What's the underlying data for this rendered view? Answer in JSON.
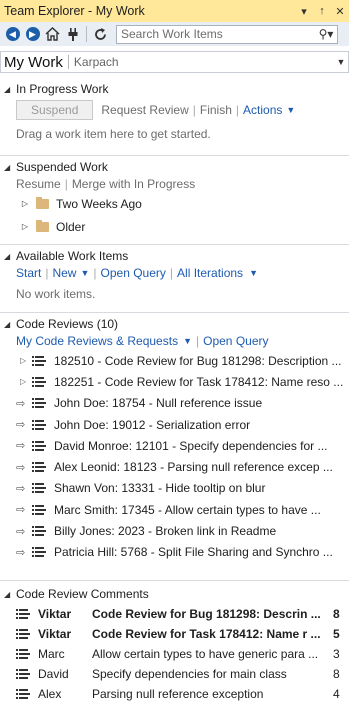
{
  "window": {
    "title": "Team Explorer - My Work",
    "pin": "↑",
    "dropdown": "▾",
    "close": "✕"
  },
  "toolbar": {
    "search_placeholder": "Search Work Items"
  },
  "nav": {
    "title": "My Work",
    "context": "Karpach"
  },
  "in_progress": {
    "header": "In Progress Work",
    "suspend": "Suspend",
    "request_review": "Request Review",
    "finish": "Finish",
    "actions": "Actions",
    "hint": "Drag a work item here to get started."
  },
  "suspended": {
    "header": "Suspended Work",
    "resume": "Resume",
    "merge": "Merge with In Progress",
    "folders": [
      "Two Weeks Ago",
      "Older"
    ]
  },
  "available": {
    "header": "Available Work Items",
    "start": "Start",
    "new": "New",
    "open_query": "Open Query",
    "all_iterations": "All Iterations",
    "empty": "No work items."
  },
  "code_reviews": {
    "header": "Code Reviews (10)",
    "my_requests": "My Code Reviews & Requests",
    "open_query": "Open Query",
    "items": [
      {
        "expand": true,
        "text": "182510 - Code Review for Bug 181298: Description ..."
      },
      {
        "expand": true,
        "text": "182251 - Code Review for Task 178412: Name reso ..."
      },
      {
        "expand": false,
        "text": "John Doe: 18754 - Null reference issue"
      },
      {
        "expand": false,
        "text": "John Doe: 19012 - Serialization error"
      },
      {
        "expand": false,
        "text": "David Monroe: 12101 - Specify dependencies for ..."
      },
      {
        "expand": false,
        "text": "Alex Leonid: 18123 - Parsing null reference excep ..."
      },
      {
        "expand": false,
        "text": "Shawn Von: 13331 - Hide tooltip on blur"
      },
      {
        "expand": false,
        "text": "Marc Smith: 17345 - Allow certain types to have ..."
      },
      {
        "expand": false,
        "text": "Billy Jones: 2023 - Broken link in Readme"
      },
      {
        "expand": false,
        "text": "Patricia Hill: 5768 - Split File Sharing and Synchro ..."
      }
    ]
  },
  "comments": {
    "header": "Code Review Comments",
    "items": [
      {
        "who": "Viktar",
        "text": "Code Review for Bug 181298: Descrin ...",
        "count": "8",
        "bold": true
      },
      {
        "who": "Viktar",
        "text": "Code Review for Task 178412: Name r ...",
        "count": "5",
        "bold": true
      },
      {
        "who": "Marc",
        "text": "Allow certain types to have generic para ...",
        "count": "3",
        "bold": false
      },
      {
        "who": "David",
        "text": "Specify dependencies for main class",
        "count": "8",
        "bold": false
      },
      {
        "who": "Alex",
        "text": "Parsing null reference exception",
        "count": "4",
        "bold": false
      }
    ]
  }
}
